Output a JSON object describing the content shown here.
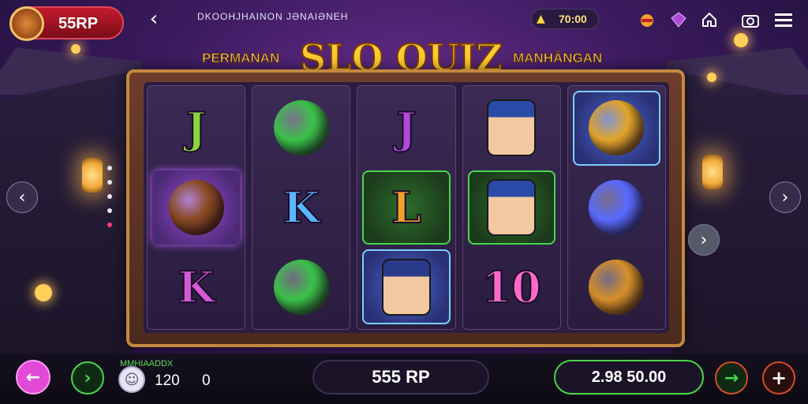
{
  "topbar": {
    "rp_balance": "55RP",
    "back_label": "‹",
    "subtitle": "DKOOHJHAINON JƏNAIƏNEH",
    "credit_value": "70:00"
  },
  "banner": {
    "left_text": "PERMANAN",
    "main_text": "SLO OUIZ",
    "right_text": "MANHĀNGAN"
  },
  "reels": [
    [
      {
        "type": "letter",
        "text": "J",
        "color": "#8ad63a"
      },
      {
        "type": "orb",
        "color": "#8a4a22"
      },
      {
        "type": "letter",
        "text": "K",
        "color": "#d65ad6"
      }
    ],
    [
      {
        "type": "orb",
        "color": "#3ac24a"
      },
      {
        "type": "letter",
        "text": "K",
        "color": "#5ab6ff"
      },
      {
        "type": "orb",
        "color": "#3ac24a"
      }
    ],
    [
      {
        "type": "letter",
        "text": "J",
        "color": "#b04ad6"
      },
      {
        "type": "letter",
        "text": "L",
        "color": "#f2a02a"
      },
      {
        "type": "face",
        "color": "#2a3a8a"
      }
    ],
    [
      {
        "type": "face",
        "color": "#2a4aa8"
      },
      {
        "type": "face",
        "color": "#2a4aa8"
      },
      {
        "type": "letter",
        "text": "10",
        "color": "#ff6ac8"
      }
    ],
    [
      {
        "type": "orb",
        "color": "#e2a52a"
      },
      {
        "type": "orb",
        "color": "#5a6aff"
      },
      {
        "type": "orb",
        "color": "#d6902a"
      }
    ],
    [
      {
        "type": "orb",
        "color": "#b44ad6"
      },
      {
        "type": "orb",
        "color": "#e0a82a"
      },
      {
        "type": "orb",
        "color": "#c88a2a"
      }
    ]
  ],
  "bottom": {
    "back_label": "←",
    "play_label": "›",
    "lion_icon": "lion-icon",
    "bet_label": "MMHIAADDX",
    "bet_value": "120",
    "bet_zero": "0",
    "total": "555 RP",
    "win_value": "2.98 50.00",
    "go_label": "→",
    "plus_label": "+"
  },
  "colors": {
    "accent_red": "#c21b2c",
    "accent_green": "#48d64c",
    "accent_pink": "#e24ad6",
    "gold": "#ffcc33"
  }
}
